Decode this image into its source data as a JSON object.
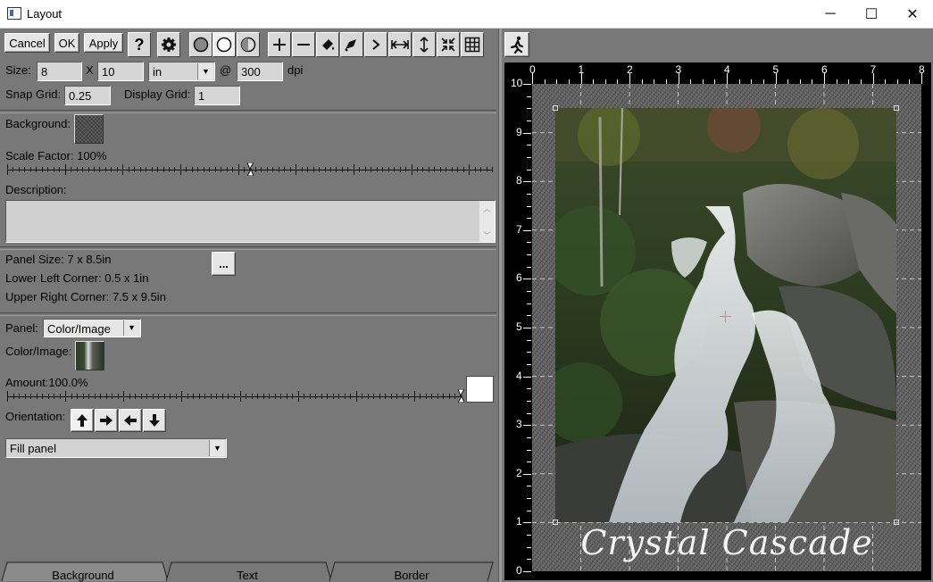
{
  "window": {
    "title": "Layout",
    "minimize": "─",
    "maximize": "☐",
    "close": "✕"
  },
  "toolbar": {
    "cancel": "Cancel",
    "ok": "OK",
    "apply": "Apply",
    "help": "?"
  },
  "size": {
    "label": "Size:",
    "width": "8",
    "x_sep": "X",
    "height": "10",
    "unit": "in",
    "at": "@",
    "dpi_value": "300",
    "dpi_label": "dpi"
  },
  "grid": {
    "snap_label": "Snap Grid:",
    "snap_value": "0.25",
    "display_label": "Display Grid:",
    "display_value": "1"
  },
  "background": {
    "label": "Background:",
    "scale_label": "Scale Factor: 100%",
    "scale_fraction": 0.5,
    "description_label": "Description:",
    "description_value": ""
  },
  "panel_info": {
    "size": "Panel Size: 7 x 8.5in",
    "lower_left": "Lower Left Corner: 0.5 x 1in",
    "upper_right": "Upper Right Corner: 7.5 x 9.5in",
    "more": "..."
  },
  "panel": {
    "label": "Panel:",
    "type": "Color/Image",
    "color_image_label": "Color/Image:",
    "amount_label": "Amount:100.0%",
    "amount_fraction": 1.0,
    "orientation_label": "Orientation:",
    "fill_mode": "Fill panel"
  },
  "tabs": [
    {
      "label": "Background"
    },
    {
      "label": "Text"
    },
    {
      "label": "Border"
    }
  ],
  "canvas": {
    "caption": "Crystal Cascade",
    "x_ticks": [
      "0",
      "1",
      "2",
      "3",
      "4",
      "5",
      "6",
      "7",
      "8"
    ],
    "y_ticks": [
      "10",
      "9",
      "8",
      "7",
      "6",
      "5",
      "4",
      "3",
      "2",
      "1",
      "0"
    ]
  },
  "icons": [
    "help-icon",
    "gear-icon",
    "circle-fill-icon",
    "circle-outline-icon",
    "circle-half-icon",
    "plus-icon",
    "minus-icon",
    "fill-bucket-icon",
    "fill-bucket-alt-icon",
    "chevron-right-icon",
    "horizontal-arrows-icon",
    "vertical-arrows-icon",
    "shrink-icon",
    "grid-icon",
    "runner-icon"
  ]
}
